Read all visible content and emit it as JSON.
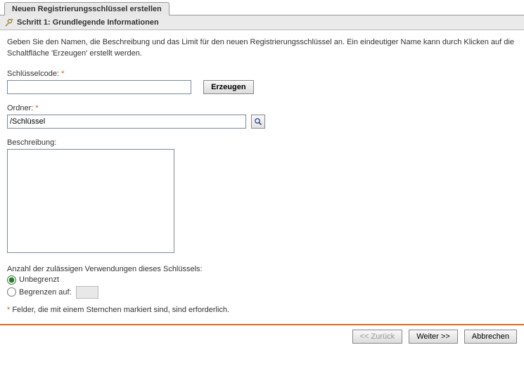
{
  "tab": {
    "title": "Neuen Registrierungsschlüssel erstellen"
  },
  "step": {
    "title": "Schritt 1: Grundlegende Informationen"
  },
  "instruction": "Geben Sie den Namen, die Beschreibung und das Limit für den neuen Registrierungsschlüssel an. Ein eindeutiger Name kann durch Klicken auf die Schaltfläche 'Erzeugen' erstellt werden.",
  "fields": {
    "key": {
      "label": "Schlüsselcode:",
      "value": "",
      "generate": "Erzeugen"
    },
    "folder": {
      "label": "Ordner:",
      "value": "/Schlüssel"
    },
    "description": {
      "label": "Beschreibung:",
      "value": ""
    }
  },
  "usage": {
    "label": "Anzahl der zulässigen Verwendungen dieses Schlüssels:",
    "options": {
      "unlimited": "Unbegrenzt",
      "limited": "Begrenzen auf:"
    },
    "limit_value": ""
  },
  "footnote_star": "*",
  "footnote": " Felder, die mit einem Sternchen markiert sind, sind erforderlich.",
  "footer": {
    "back": "<< Zurück",
    "next": "Weiter >>",
    "cancel": "Abbrechen"
  }
}
